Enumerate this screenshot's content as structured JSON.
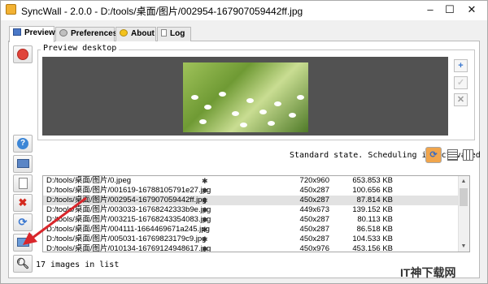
{
  "window": {
    "title": "SyncWall - 2.0.0 - D:/tools/桌面/图片/002954-167907059442ff.jpg"
  },
  "titlebar": {
    "minimize": "–",
    "maximize": "☐",
    "close": "✕"
  },
  "tabs": [
    {
      "label": "Preview",
      "active": true
    },
    {
      "label": "Preferences",
      "active": false
    },
    {
      "label": "About",
      "active": false
    },
    {
      "label": "Log",
      "active": false
    }
  ],
  "preview": {
    "group_label": "Preview desktop"
  },
  "status": {
    "text": "Standard state. Scheduling is activated"
  },
  "list": {
    "star": "✱",
    "items": [
      {
        "path": "D:/tools/桌面/图片/0.jpeg",
        "dims": "720x960",
        "size": "653.853 KB",
        "selected": false
      },
      {
        "path": "D:/tools/桌面/图片/001619-16788105791e27.jpg",
        "dims": "450x287",
        "size": "100.656 KB",
        "selected": false
      },
      {
        "path": "D:/tools/桌面/图片/002954-167907059442ff.jpg",
        "dims": "450x287",
        "size": "87.814 KB",
        "selected": true
      },
      {
        "path": "D:/tools/桌面/图片/003033-16768242333b9e.jpg",
        "dims": "449x673",
        "size": "139.152 KB",
        "selected": false
      },
      {
        "path": "D:/tools/桌面/图片/003215-16768243354083.jpg",
        "dims": "450x287",
        "size": "80.113 KB",
        "selected": false
      },
      {
        "path": "D:/tools/桌面/图片/004111-1664469671a245.jpg",
        "dims": "450x287",
        "size": "86.518 KB",
        "selected": false
      },
      {
        "path": "D:/tools/桌面/图片/005031-16769823179c9.jpg",
        "dims": "450x287",
        "size": "104.533 KB",
        "selected": false
      },
      {
        "path": "D:/tools/桌面/图片/010134-16769124948617.jpg",
        "dims": "450x976",
        "size": "453.156 KB",
        "selected": false
      }
    ]
  },
  "footer": {
    "count": "17 images in list"
  },
  "watermark": {
    "text": "IT神下载网"
  },
  "colors": {
    "desktop_bg": "#525252",
    "selected_row": "#e2e2e2",
    "arrow": "#d9262b",
    "power_button": "#e0443a"
  }
}
